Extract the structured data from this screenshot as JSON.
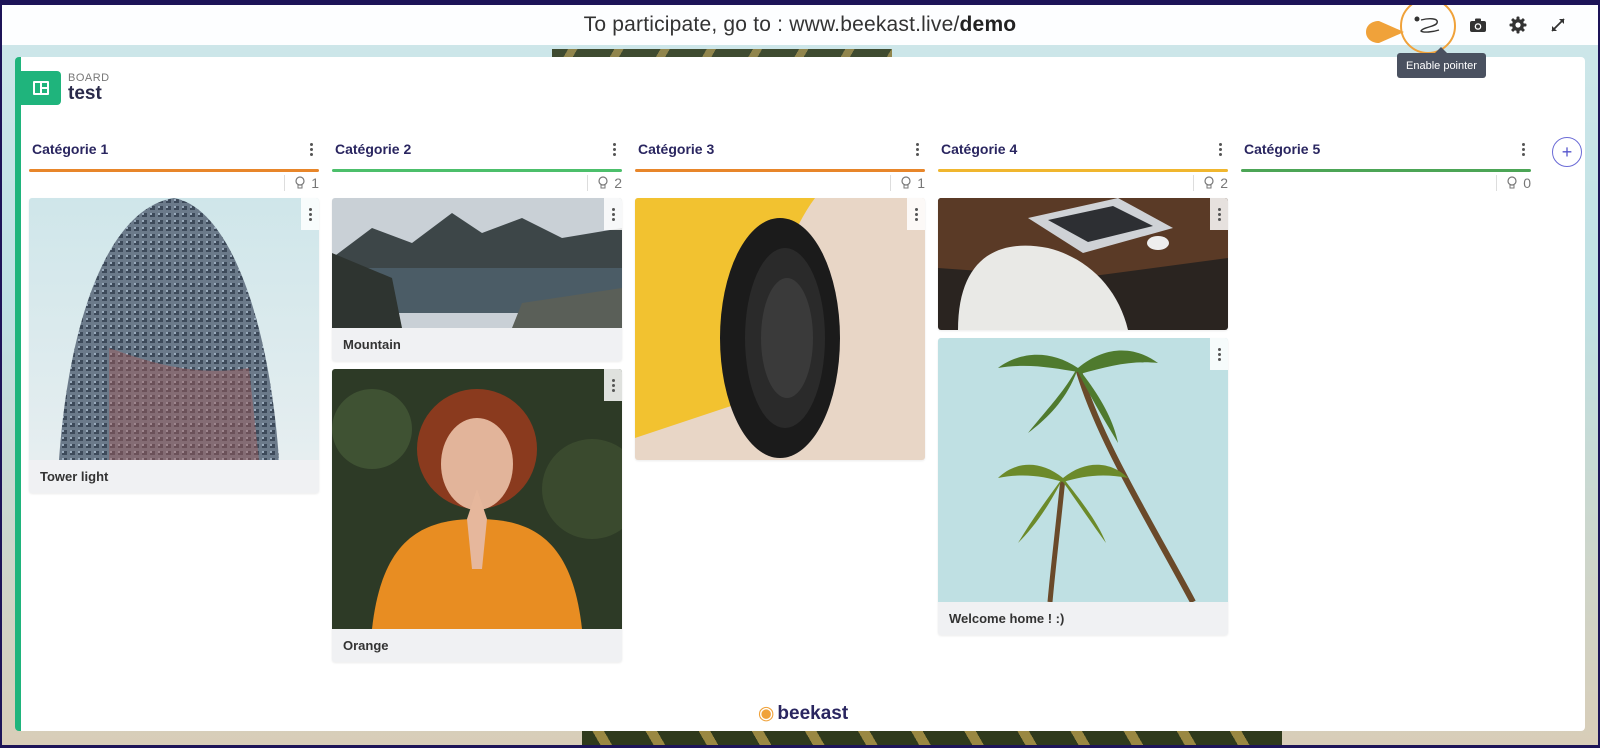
{
  "topbar": {
    "participate_prefix": "To participate, go to : www.beekast.live/",
    "participate_code": "demo",
    "tools": [
      {
        "name": "pointer-icon",
        "label": "Enable pointer"
      },
      {
        "name": "camera-icon"
      },
      {
        "name": "gear-icon"
      },
      {
        "name": "expand-icon"
      }
    ],
    "tooltip": "Enable pointer",
    "accent": "#f0a23a"
  },
  "board": {
    "kicker": "BOARD",
    "title": "test",
    "accent": "#1fb47c"
  },
  "columns": [
    {
      "title": "Catégorie 1",
      "color": "#e8862a",
      "count": "1",
      "cards": [
        {
          "label": "Tower light",
          "image": "glass-tower"
        }
      ]
    },
    {
      "title": "Catégorie 2",
      "color": "#4cbf6b",
      "count": "2",
      "cards": [
        {
          "label": "Mountain",
          "image": "mountain-fjord"
        },
        {
          "label": "Orange",
          "image": "woman-orange-jacket"
        }
      ]
    },
    {
      "title": "Catégorie 3",
      "color": "#e8862a",
      "count": "1",
      "cards": [
        {
          "label": "",
          "image": "yellow-car-wheel"
        }
      ]
    },
    {
      "title": "Catégorie 4",
      "color": "#f0b62e",
      "count": "2",
      "cards": [
        {
          "label": "",
          "image": "laptop-desk"
        },
        {
          "label": "Welcome home ! :)",
          "image": "palm-trees"
        }
      ]
    },
    {
      "title": "Catégorie 5",
      "color": "#4ca556",
      "count": "0",
      "cards": []
    }
  ],
  "footer": {
    "brand": "beekast"
  }
}
